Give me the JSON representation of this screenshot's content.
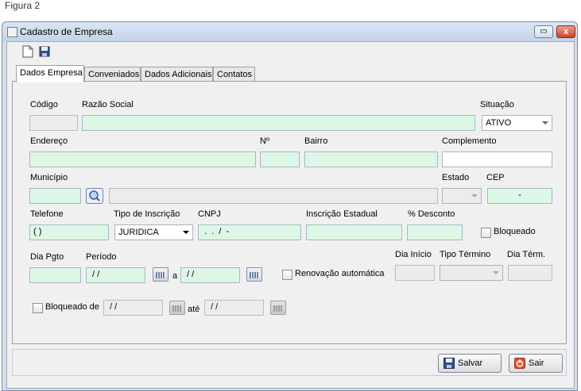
{
  "caption": "Figura 2",
  "window": {
    "title": "Cadastro de Empresa",
    "controls": {
      "restore": "▭",
      "close": "x"
    }
  },
  "toolbar": [
    "new-document-icon",
    "save-icon"
  ],
  "tabs": [
    {
      "label": "Dados Empresa",
      "active": true
    },
    {
      "label": "Conveniados",
      "active": false
    },
    {
      "label": "Dados Adicionais",
      "active": false
    },
    {
      "label": "Contatos",
      "active": false
    }
  ],
  "form": {
    "codigo": {
      "label": "Código",
      "value": ""
    },
    "razao_social": {
      "label": "Razão Social",
      "value": ""
    },
    "situacao": {
      "label": "Situação",
      "value": "ATIVO"
    },
    "endereco": {
      "label": "Endereço",
      "value": ""
    },
    "numero": {
      "label": "Nº",
      "value": ""
    },
    "bairro": {
      "label": "Bairro",
      "value": ""
    },
    "complemento": {
      "label": "Complemento",
      "value": ""
    },
    "municipio": {
      "label": "Município",
      "code": "",
      "name": ""
    },
    "estado": {
      "label": "Estado",
      "value": ""
    },
    "cep": {
      "label": "CEP",
      "value": "-"
    },
    "telefone": {
      "label": "Telefone",
      "value": "( )"
    },
    "tipo_inscricao": {
      "label": "Tipo de Inscrição",
      "value": "JURIDICA"
    },
    "cnpj": {
      "label": "CNPJ",
      "value": " .  .  /  -"
    },
    "inscricao_estadual": {
      "label": "Inscrição Estadual",
      "value": ""
    },
    "desconto": {
      "label": "% Desconto",
      "value": ""
    },
    "bloqueado": {
      "label": "Bloqueado",
      "checked": false
    },
    "dia_pgto": {
      "label": "Dia Pgto",
      "value": ""
    },
    "periodo": {
      "label": "Período",
      "from": " / /",
      "sep": "a",
      "to": " / /"
    },
    "renovacao": {
      "label": "Renovação automática",
      "checked": false
    },
    "dia_inicio": {
      "label": "Dia Início",
      "value": ""
    },
    "tipo_termino": {
      "label": "Tipo Término",
      "value": ""
    },
    "dia_termino": {
      "label": "Dia Térm.",
      "value": ""
    },
    "bloqueado_de": {
      "label": "Bloqueado de",
      "from": " / /",
      "sep": "até",
      "to": " / /",
      "checked": false
    }
  },
  "buttons": {
    "salvar": "Salvar",
    "sair": "Sair"
  },
  "colors": {
    "field_bg": "#ddf7e6",
    "window_border": "#7a8ca5"
  }
}
